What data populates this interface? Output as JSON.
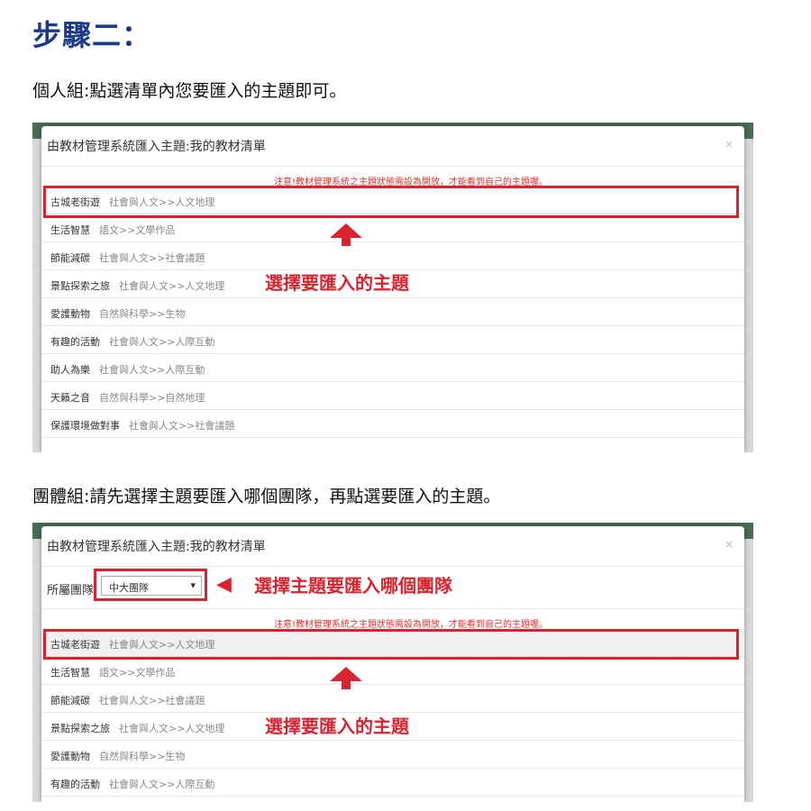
{
  "step_title": "步驟二：",
  "desc1": "個人組:點選清單內您要匯入的主題即可。",
  "desc2": "團體組:請先選擇主題要匯入哪個團隊，再點選要匯入的主題。",
  "modal": {
    "title": "由教材管理系統匯入主題:我的教材清單",
    "close": "×",
    "notice": "注意!教材管理系統之主題狀態需設為開放，才能看到自己的主題喔。"
  },
  "list1": [
    {
      "title": "古城老街遊",
      "category": "社會與人文>>人文地理"
    },
    {
      "title": "生活智慧",
      "category": "語文>>文學作品"
    },
    {
      "title": "節能減碳",
      "category": "社會與人文>>社會議題"
    },
    {
      "title": "景點探索之旅",
      "category": "社會與人文>>人文地理"
    },
    {
      "title": "愛護動物",
      "category": "自然與科學>>生物"
    },
    {
      "title": "有趣的活動",
      "category": "社會與人文>>人際互動"
    },
    {
      "title": "助人為樂",
      "category": "社會與人文>>人際互動"
    },
    {
      "title": "天籟之音",
      "category": "自然與科學>>自然地理"
    },
    {
      "title": "保護環境做對事",
      "category": "社會與人文>>社會議題"
    }
  ],
  "list2": [
    {
      "title": "古城老街遊",
      "category": "社會與人文>>人文地理"
    },
    {
      "title": "生活智慧",
      "category": "語文>>文學作品"
    },
    {
      "title": "節能減碳",
      "category": "社會與人文>>社會議題"
    },
    {
      "title": "景點探索之旅",
      "category": "社會與人文>>人文地理"
    },
    {
      "title": "愛護動物",
      "category": "自然與科學>>生物"
    },
    {
      "title": "有趣的活動",
      "category": "社會與人文>>人際互動"
    }
  ],
  "team": {
    "label": "所屬團隊:",
    "selected": "中大團隊"
  },
  "annotations": {
    "select_topic": "選擇要匯入的主題",
    "select_team": "選擇主題要匯入哪個團隊"
  },
  "colors": {
    "highlight": "#d9232e",
    "title": "#1d3a8a"
  }
}
